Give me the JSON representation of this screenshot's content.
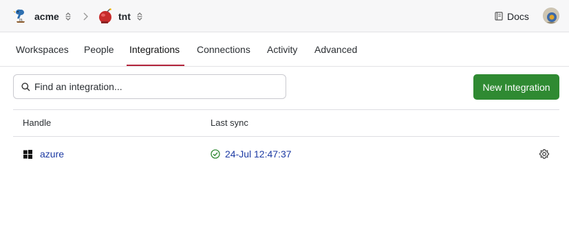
{
  "header": {
    "org": {
      "name": "acme",
      "icon": "bird-logo-icon"
    },
    "project": {
      "name": "tnt",
      "icon": "tnt-logo-icon"
    },
    "docs_label": "Docs",
    "avatar": "user-avatar"
  },
  "tabs": [
    {
      "label": "Workspaces",
      "active": false
    },
    {
      "label": "People",
      "active": false
    },
    {
      "label": "Integrations",
      "active": true
    },
    {
      "label": "Connections",
      "active": false
    },
    {
      "label": "Activity",
      "active": false
    },
    {
      "label": "Advanced",
      "active": false
    }
  ],
  "search": {
    "placeholder": "Find an integration...",
    "value": ""
  },
  "new_button_label": "New Integration",
  "table": {
    "columns": [
      "Handle",
      "Last sync"
    ],
    "rows": [
      {
        "icon": "windows-icon",
        "handle": "azure",
        "status": "success",
        "last_sync": "24-Jul 12:47:37"
      }
    ]
  },
  "colors": {
    "accent_tab": "#b3243b",
    "primary_button": "#2f8a32",
    "link": "#1c3aa3",
    "success": "#2f8a32"
  }
}
